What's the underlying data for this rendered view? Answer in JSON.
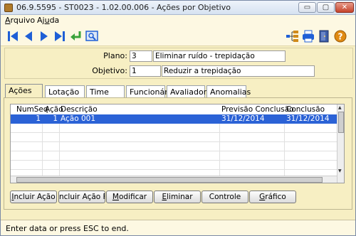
{
  "window": {
    "title": "06.9.5595 - ST0023 - 1.02.00.006 - Ações por Objetivo",
    "controls": {
      "minimize": "▭",
      "maximize": "▢",
      "close": "✕"
    }
  },
  "menu": {
    "arquivo_first": "A",
    "arquivo_rest": "rquivo",
    "ajuda_first": "Aj",
    "ajuda_u": "u",
    "ajuda_rest": "da"
  },
  "toolbar": {
    "buttons": [
      "first-record-icon",
      "previous-record-icon",
      "next-record-icon",
      "last-record-icon",
      "return-icon",
      "preview-icon",
      "tree-icon",
      "print-icon",
      "exit-door-icon",
      "help-icon"
    ],
    "accent": "#1f5fd6"
  },
  "header": {
    "plano_label": "Plano:",
    "plano_code": "3",
    "plano_desc": "Eliminar ruído - trepidação",
    "objetivo_label": "Objetivo:",
    "objetivo_code": "1",
    "objetivo_desc": "Reduzir a trepidação"
  },
  "tabs": [
    {
      "label": "Ações",
      "active": true
    },
    {
      "label": "Lotação",
      "active": false
    },
    {
      "label": "Time",
      "active": false
    },
    {
      "label": "Funcionário",
      "active": false
    },
    {
      "label": "Avaliador",
      "active": false
    },
    {
      "label": "Anomalias",
      "active": false
    }
  ],
  "grid": {
    "columns": [
      "NumSeq",
      "Ação",
      "Descrição",
      "Previsão Conclusão",
      "Conclusão"
    ],
    "rows": [
      {
        "numseq": "1",
        "acao": "1",
        "descricao": "Ação 001",
        "previsao": "31/12/2014",
        "conclusao": "31/12/2014",
        "selected": true
      }
    ]
  },
  "buttons": {
    "incluir_acao_u": "I",
    "incluir_acao_rest": "ncluir Ação",
    "incluir_acao_filho": "ncluir Ação Filho",
    "modificar_u": "M",
    "modificar_rest": "odificar",
    "eliminar_u": "E",
    "eliminar_rest": "liminar",
    "controle": "Controle",
    "grafico_u": "G",
    "grafico_rest": "ráfico"
  },
  "status": {
    "text": "Enter data or press ESC to end."
  },
  "colors": {
    "window_bg": "#f7efc3",
    "selection": "#2b62d6"
  }
}
